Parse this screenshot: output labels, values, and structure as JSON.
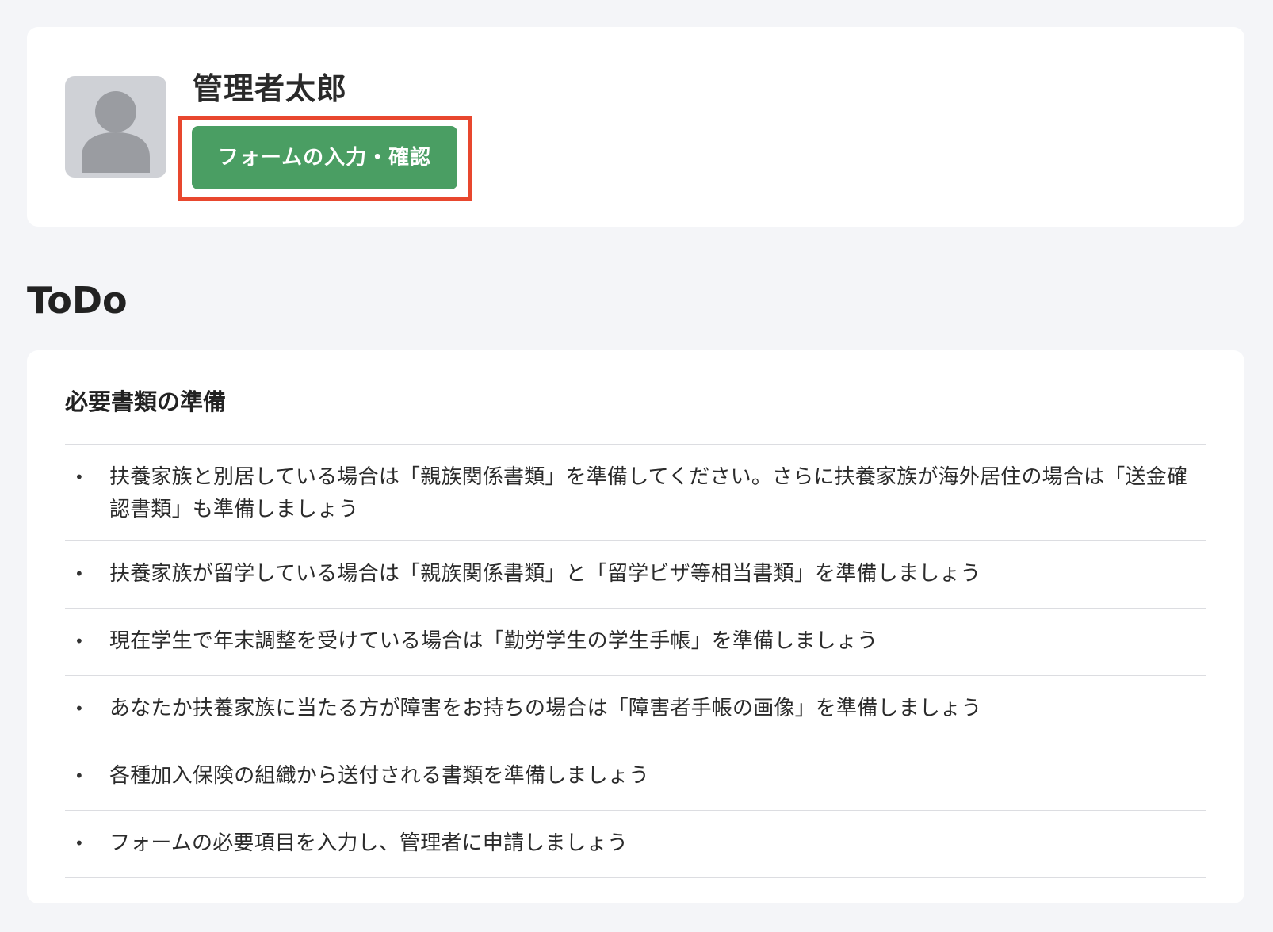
{
  "profile": {
    "name": "管理者太郎",
    "form_button_label": "フォームの入力・確認"
  },
  "todo": {
    "heading": "ToDo",
    "card_title": "必要書類の準備",
    "items": [
      {
        "bullet": "•",
        "text": "扶養家族と別居している場合は「親族関係書類」を準備してください。さらに扶養家族が海外居住の場合は「送金確認書類」も準備しましょう"
      },
      {
        "bullet": "•",
        "text": "扶養家族が留学している場合は「親族関係書類」と「留学ビザ等相当書類」を準備しましょう"
      },
      {
        "bullet": "•",
        "text": "現在学生で年末調整を受けている場合は「勤労学生の学生手帳」を準備しましょう"
      },
      {
        "bullet": "•",
        "text": "あなたか扶養家族に当たる方が障害をお持ちの場合は「障害者手帳の画像」を準備しましょう"
      },
      {
        "bullet": "•",
        "text": "各種加入保険の組織から送付される書類を準備しましょう"
      },
      {
        "bullet": "•",
        "text": "フォームの必要項目を入力し、管理者に申請しましょう"
      }
    ]
  },
  "colors": {
    "page_background": "#f4f5f8",
    "card_background": "#ffffff",
    "primary_button": "#4a9e63",
    "highlight_frame": "#e8472e",
    "avatar_background": "#cfd1d6",
    "avatar_figure": "#9a9ca1",
    "divider": "#dcdde1"
  },
  "icons": {
    "avatar": "user-silhouette-icon"
  }
}
